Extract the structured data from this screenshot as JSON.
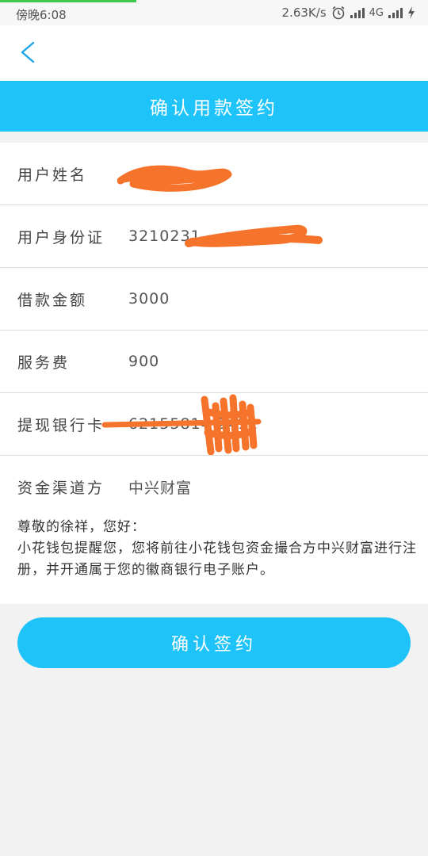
{
  "status_bar": {
    "time": "傍晚6:08",
    "net_speed": "2.63K/s",
    "network_type": "4G",
    "icons": [
      "alarm-icon",
      "signal-icon",
      "signal-icon",
      "charging-icon"
    ]
  },
  "nav": {
    "back_icon": "chevron-left-icon"
  },
  "header": {
    "title": "确认用款签约"
  },
  "form": {
    "rows": [
      {
        "label": "用户姓名",
        "value": ""
      },
      {
        "label": "用户身份证",
        "value": "3210231"
      },
      {
        "label": "借款金额",
        "value": "3000"
      },
      {
        "label": "服务费",
        "value": "900"
      },
      {
        "label": "提现银行卡",
        "value": "62155814            2411"
      },
      {
        "label": "资金渠道方",
        "value": "中兴财富"
      }
    ]
  },
  "notice": {
    "greeting": "尊敬的徐祥，您好：",
    "body": "小花钱包提醒您，您将前往小花钱包资金撮合方中兴财富进行注册，并开通属于您的徽商银行电子账户。"
  },
  "actions": {
    "confirm_label": "确认签约"
  },
  "colors": {
    "accent": "#1ec3f9",
    "redaction": "#f5732b",
    "progress": "#3ec94e"
  }
}
